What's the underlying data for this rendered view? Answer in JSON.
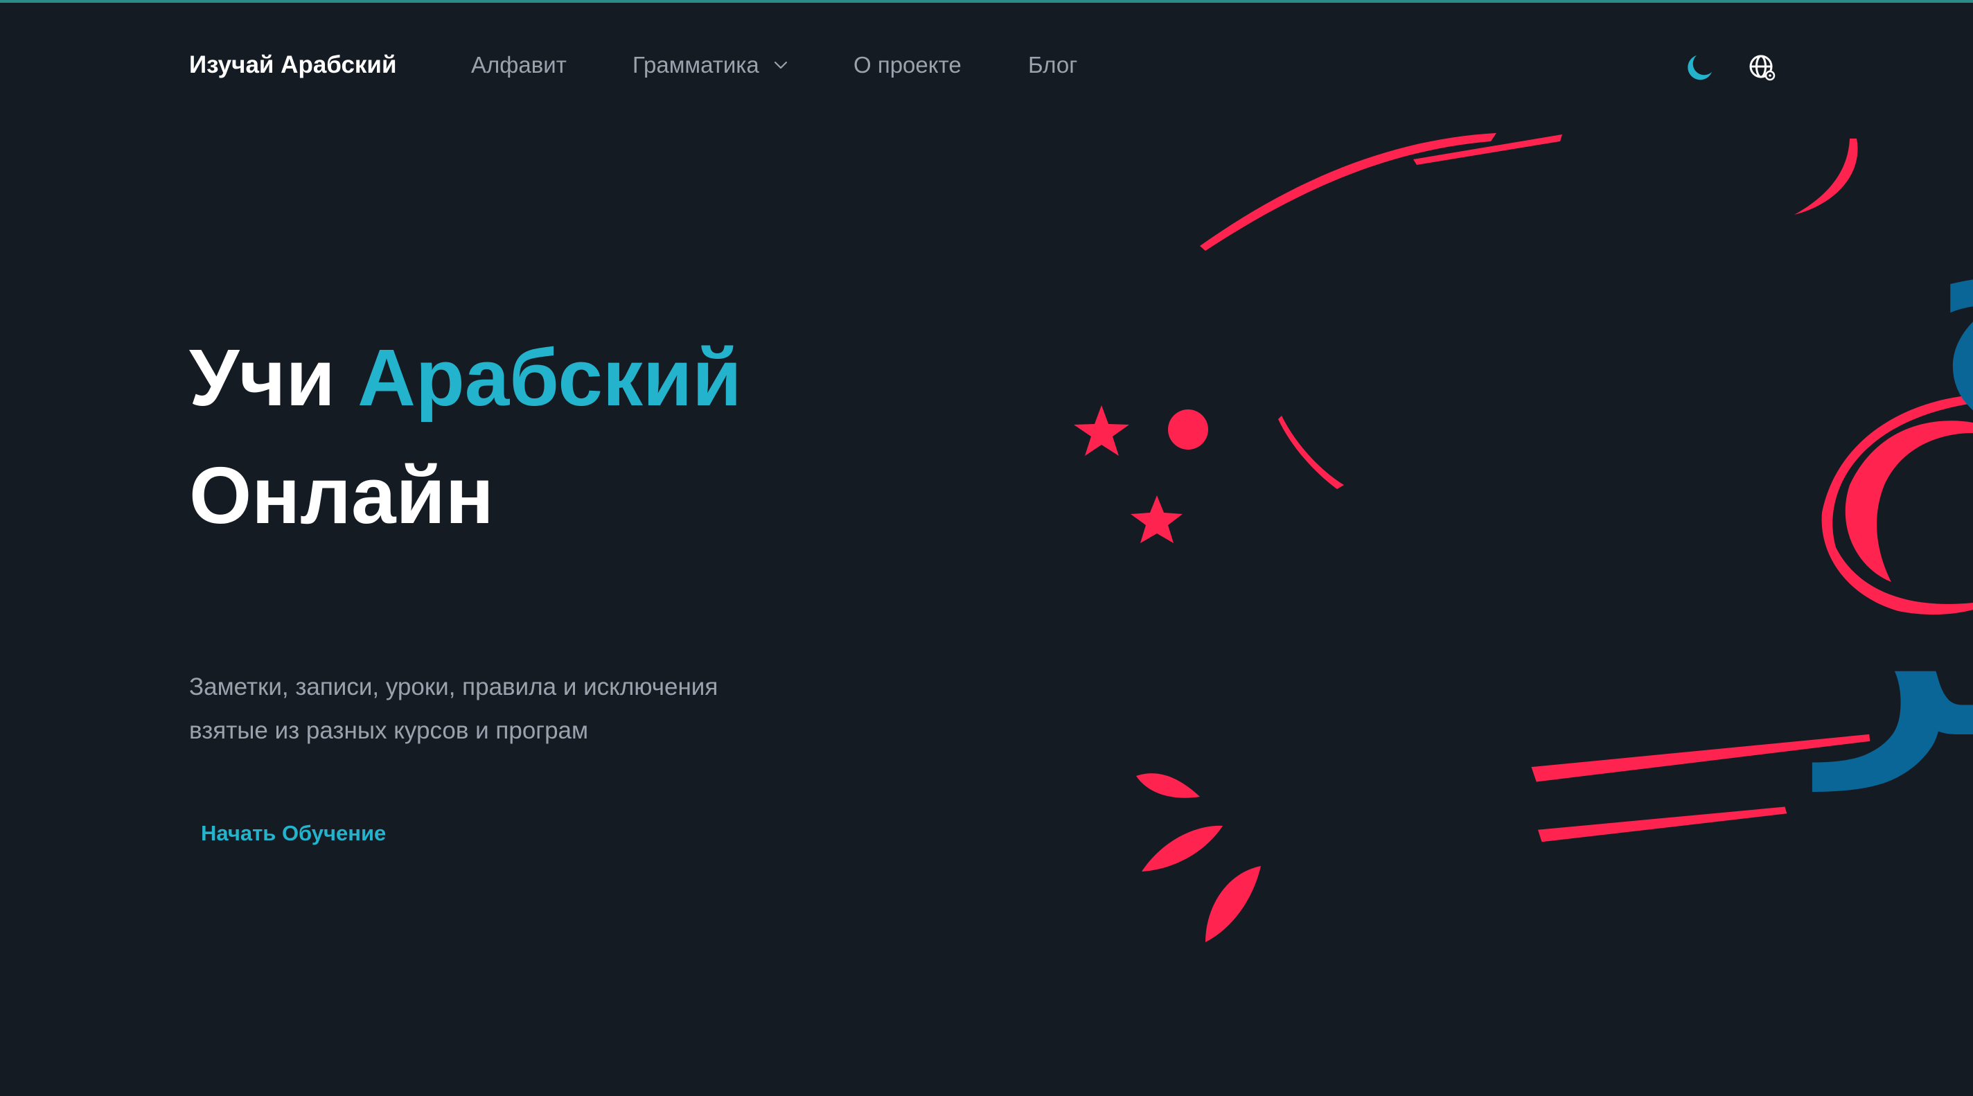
{
  "header": {
    "brand": "Изучай Арабский",
    "nav": {
      "alphabet": "Алфавит",
      "grammar": "Грамматика",
      "about": "О проекте",
      "blog": "Блог"
    },
    "icons": {
      "theme_toggle": "moon-icon",
      "language": "globe-icon",
      "grammar_dropdown": "chevron-down-icon"
    }
  },
  "hero": {
    "title_part1": "Учи",
    "title_accent": "Арабский",
    "title_part2": "Онлайн",
    "subtitle_line1": "Заметки, записи, уроки, правила и исключения",
    "subtitle_line2": "взятые из разных курсов и програм",
    "cta": "Начать Обучение"
  },
  "illustration": {
    "arabic_line1": "صَباح",
    "arabic_line2": "الخير"
  },
  "colors": {
    "background": "#151b23",
    "accent": "#24b3cc",
    "calligraphy": "#0a6696",
    "decoration": "#ff2450",
    "muted_text": "#9aa3ad",
    "top_line": "#2a8c86"
  }
}
